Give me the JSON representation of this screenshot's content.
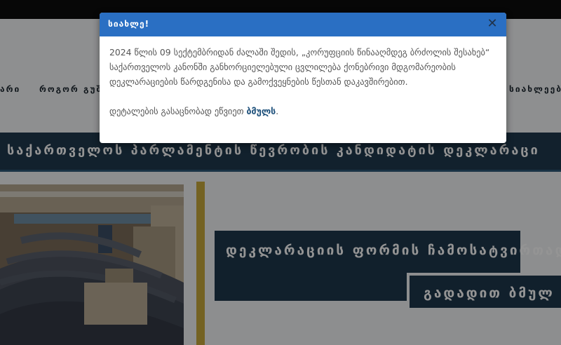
{
  "nav": {
    "item_left": "არი",
    "item_how": "როგორ გუშ",
    "item_news": "სიახლეები"
  },
  "banner": {
    "title": "საქართველოს პარლამენტის წევრობის კანდიდატის დეკლარაცი"
  },
  "hero": {
    "form_button": "დეკლარაციის ფორმის ჩამოსატვირთად",
    "more_button": "გადადით ბმულ"
  },
  "modal": {
    "title": "სიახლე!",
    "close": "✕",
    "paragraph1": "2024 წლის 09 სექტემბრიდან ძალაში შედის, „კორუფციის წინააღმდეგ ბრძოლის შესახებ“ საქართველოს კანონში განხორციელებული ცვლილება ქონებრივი მდგომარეობის დეკლარაციების წარდგენისა და გამოქვეყნების წესთან დაკავშირებით.",
    "paragraph2_text": "დეტალების გასაცნობად ეწვიეთ ",
    "link": "ბმულს",
    "trailing": "."
  },
  "colors": {
    "modal_header": "#2a6fc3",
    "banner": "#20394f",
    "gold_accent": "#c9a93b",
    "top_bar": "#0d0d0d"
  }
}
